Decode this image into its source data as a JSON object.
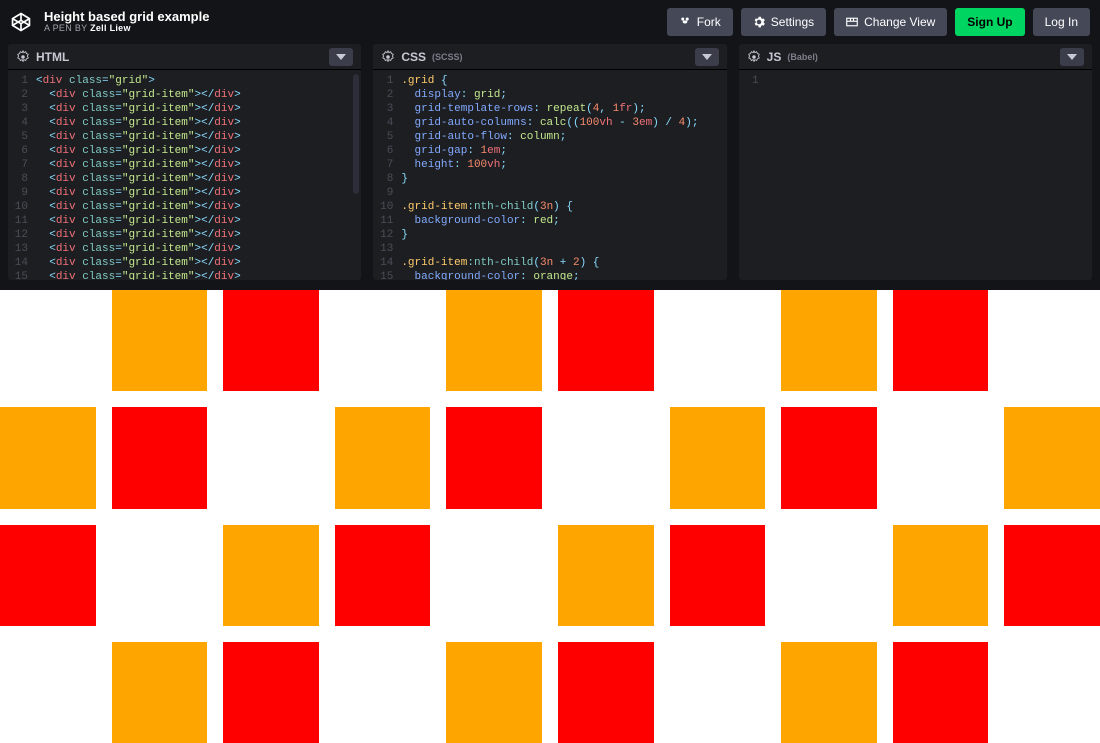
{
  "header": {
    "title": "Height based grid example",
    "byline_prefix": "A PEN BY ",
    "author": "Zell Liew",
    "buttons": {
      "fork": "Fork",
      "settings": "Settings",
      "change_view": "Change View",
      "signup": "Sign Up",
      "login": "Log In"
    }
  },
  "panels": {
    "html": {
      "title": "HTML",
      "sub": ""
    },
    "css": {
      "title": "CSS",
      "sub": "(SCSS)"
    },
    "js": {
      "title": "JS",
      "sub": "(Babel)"
    }
  },
  "html_code": {
    "lines": [
      {
        "n": "1",
        "indent": 0,
        "tag": "div",
        "cls": "grid",
        "close": false
      },
      {
        "n": "2",
        "indent": 1,
        "tag": "div",
        "cls": "grid-item",
        "close": true
      },
      {
        "n": "3",
        "indent": 1,
        "tag": "div",
        "cls": "grid-item",
        "close": true
      },
      {
        "n": "4",
        "indent": 1,
        "tag": "div",
        "cls": "grid-item",
        "close": true
      },
      {
        "n": "5",
        "indent": 1,
        "tag": "div",
        "cls": "grid-item",
        "close": true
      },
      {
        "n": "6",
        "indent": 1,
        "tag": "div",
        "cls": "grid-item",
        "close": true
      },
      {
        "n": "7",
        "indent": 1,
        "tag": "div",
        "cls": "grid-item",
        "close": true
      },
      {
        "n": "8",
        "indent": 1,
        "tag": "div",
        "cls": "grid-item",
        "close": true
      },
      {
        "n": "9",
        "indent": 1,
        "tag": "div",
        "cls": "grid-item",
        "close": true
      },
      {
        "n": "10",
        "indent": 1,
        "tag": "div",
        "cls": "grid-item",
        "close": true
      },
      {
        "n": "11",
        "indent": 1,
        "tag": "div",
        "cls": "grid-item",
        "close": true
      },
      {
        "n": "12",
        "indent": 1,
        "tag": "div",
        "cls": "grid-item",
        "close": true
      },
      {
        "n": "13",
        "indent": 1,
        "tag": "div",
        "cls": "grid-item",
        "close": true
      },
      {
        "n": "14",
        "indent": 1,
        "tag": "div",
        "cls": "grid-item",
        "close": true
      },
      {
        "n": "15",
        "indent": 1,
        "tag": "div",
        "cls": "grid-item",
        "close": true
      }
    ]
  },
  "css_code": {
    "lines": [
      {
        "n": "1",
        "raw": [
          [
            ".grid ",
            "sel"
          ],
          [
            "{",
            "punc"
          ]
        ]
      },
      {
        "n": "2",
        "raw": [
          [
            "  ",
            ""
          ],
          [
            "display",
            "prop"
          ],
          [
            ": ",
            "punc"
          ],
          [
            "grid",
            "val"
          ],
          [
            ";",
            "punc"
          ]
        ]
      },
      {
        "n": "3",
        "raw": [
          [
            "  ",
            ""
          ],
          [
            "grid-template-rows",
            "prop"
          ],
          [
            ": ",
            "punc"
          ],
          [
            "repeat",
            "val"
          ],
          [
            "(",
            "punc"
          ],
          [
            "4",
            "num"
          ],
          [
            ", ",
            "punc"
          ],
          [
            "1",
            "num"
          ],
          [
            "fr",
            "unit"
          ],
          [
            ")",
            "punc"
          ],
          [
            ";",
            "punc"
          ]
        ]
      },
      {
        "n": "4",
        "raw": [
          [
            "  ",
            ""
          ],
          [
            "grid-auto-columns",
            "prop"
          ],
          [
            ": ",
            "punc"
          ],
          [
            "calc",
            "val"
          ],
          [
            "((",
            "punc"
          ],
          [
            "100",
            "num"
          ],
          [
            "vh",
            "unit"
          ],
          [
            " - ",
            "punc"
          ],
          [
            "3",
            "num"
          ],
          [
            "em",
            "unit"
          ],
          [
            ") / ",
            "punc"
          ],
          [
            "4",
            "num"
          ],
          [
            ")",
            "punc"
          ],
          [
            ";",
            "punc"
          ]
        ]
      },
      {
        "n": "5",
        "raw": [
          [
            "  ",
            ""
          ],
          [
            "grid-auto-flow",
            "prop"
          ],
          [
            ": ",
            "punc"
          ],
          [
            "column",
            "val"
          ],
          [
            ";",
            "punc"
          ]
        ]
      },
      {
        "n": "6",
        "raw": [
          [
            "  ",
            ""
          ],
          [
            "grid-gap",
            "prop"
          ],
          [
            ": ",
            "punc"
          ],
          [
            "1",
            "num"
          ],
          [
            "em",
            "unit"
          ],
          [
            ";",
            "punc"
          ]
        ]
      },
      {
        "n": "7",
        "raw": [
          [
            "  ",
            ""
          ],
          [
            "height",
            "prop"
          ],
          [
            ": ",
            "punc"
          ],
          [
            "100",
            "num"
          ],
          [
            "vh",
            "unit"
          ],
          [
            ";",
            "punc"
          ]
        ]
      },
      {
        "n": "8",
        "raw": [
          [
            "}",
            "punc"
          ]
        ]
      },
      {
        "n": "9",
        "raw": [
          [
            "",
            ""
          ]
        ]
      },
      {
        "n": "10",
        "raw": [
          [
            ".grid-item",
            "sel"
          ],
          [
            ":nth-child",
            "pseudo"
          ],
          [
            "(",
            "punc"
          ],
          [
            "3n",
            "num"
          ],
          [
            ") ",
            "punc"
          ],
          [
            "{",
            "punc"
          ]
        ]
      },
      {
        "n": "11",
        "raw": [
          [
            "  ",
            ""
          ],
          [
            "background-color",
            "prop"
          ],
          [
            ": ",
            "punc"
          ],
          [
            "red",
            "val"
          ],
          [
            ";",
            "punc"
          ]
        ]
      },
      {
        "n": "12",
        "raw": [
          [
            "}",
            "punc"
          ]
        ]
      },
      {
        "n": "13",
        "raw": [
          [
            "",
            ""
          ]
        ]
      },
      {
        "n": "14",
        "raw": [
          [
            ".grid-item",
            "sel"
          ],
          [
            ":nth-child",
            "pseudo"
          ],
          [
            "(",
            "punc"
          ],
          [
            "3n",
            "num"
          ],
          [
            " + ",
            "punc"
          ],
          [
            "2",
            "num"
          ],
          [
            ") ",
            "punc"
          ],
          [
            "{",
            "punc"
          ]
        ]
      },
      {
        "n": "15",
        "raw": [
          [
            "  ",
            ""
          ],
          [
            "background-color",
            "prop"
          ],
          [
            ": ",
            "punc"
          ],
          [
            "orange",
            "val"
          ],
          [
            ";",
            "punc"
          ]
        ]
      }
    ]
  },
  "js_code": {
    "lines": [
      {
        "n": "1",
        "raw": [
          [
            "",
            ""
          ]
        ]
      }
    ]
  },
  "output": {
    "item_count": 40
  }
}
